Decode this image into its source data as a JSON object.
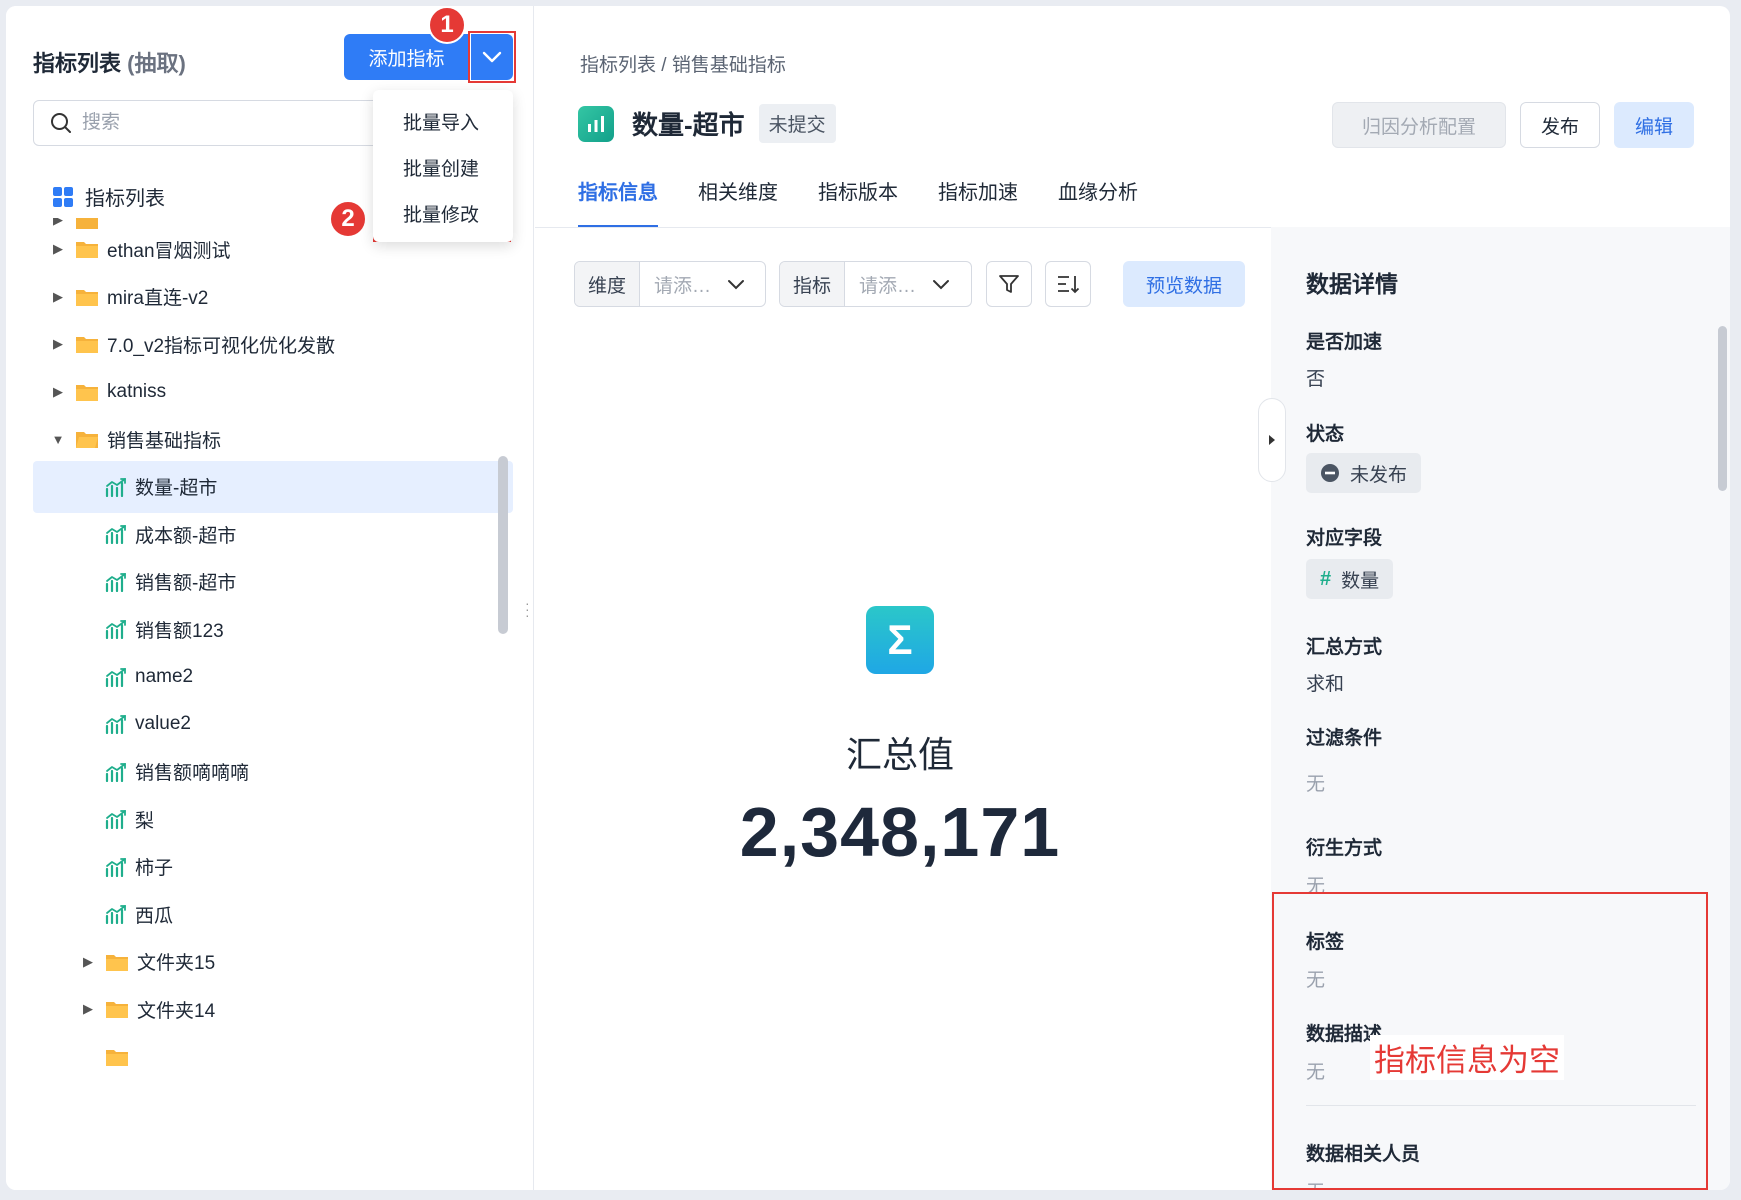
{
  "left": {
    "title": "指标列表",
    "title_suffix": "(抽取)",
    "add_button": "添加指标",
    "search_placeholder": "搜索",
    "dropdown": [
      "批量导入",
      "批量创建",
      "批量修改"
    ],
    "annotations": [
      "1",
      "2"
    ],
    "tree_root": "指标列表",
    "tree_items": [
      {
        "label": "ethan冒烟测试",
        "type": "folder",
        "level": 0,
        "expanded": false
      },
      {
        "label": "mira直连-v2",
        "type": "folder",
        "level": 0,
        "expanded": false
      },
      {
        "label": "7.0_v2指标可视化优化发散",
        "type": "folder",
        "level": 0,
        "expanded": false
      },
      {
        "label": "katniss",
        "type": "folder",
        "level": 0,
        "expanded": false
      },
      {
        "label": "销售基础指标",
        "type": "folder",
        "level": 0,
        "expanded": true
      },
      {
        "label": "数量-超市",
        "type": "metric",
        "level": 1,
        "selected": true
      },
      {
        "label": "成本额-超市",
        "type": "metric",
        "level": 1
      },
      {
        "label": "销售额-超市",
        "type": "metric",
        "level": 1
      },
      {
        "label": "销售额123",
        "type": "metric",
        "level": 1
      },
      {
        "label": "name2",
        "type": "metric",
        "level": 1
      },
      {
        "label": "value2",
        "type": "metric",
        "level": 1
      },
      {
        "label": "销售额嘀嘀嘀",
        "type": "metric",
        "level": 1
      },
      {
        "label": "梨",
        "type": "metric",
        "level": 1
      },
      {
        "label": "柿子",
        "type": "metric",
        "level": 1
      },
      {
        "label": "西瓜",
        "type": "metric",
        "level": 1
      },
      {
        "label": "文件夹15",
        "type": "folder",
        "level": 1,
        "expanded": false
      },
      {
        "label": "文件夹14",
        "type": "folder",
        "level": 1,
        "expanded": false
      }
    ]
  },
  "main": {
    "breadcrumb": "指标列表 / 销售基础指标",
    "title": "数量-超市",
    "status": "未提交",
    "buttons": {
      "attribution": "归因分析配置",
      "publish": "发布",
      "edit": "编辑"
    },
    "tabs": [
      "指标信息",
      "相关维度",
      "指标版本",
      "指标加速",
      "血缘分析"
    ],
    "filters": {
      "dimension_label": "维度",
      "dimension_placeholder": "请添…",
      "metric_label": "指标",
      "metric_placeholder": "请添…",
      "preview": "预览数据"
    },
    "summary": {
      "label": "汇总值",
      "value": "2,348,171"
    }
  },
  "detail": {
    "title": "数据详情",
    "fields": [
      {
        "label": "是否加速",
        "value": "否"
      },
      {
        "label": "状态",
        "value": "未发布"
      },
      {
        "label": "对应字段",
        "value": "数量"
      },
      {
        "label": "汇总方式",
        "value": "求和"
      },
      {
        "label": "过滤条件",
        "value": "无"
      },
      {
        "label": "衍生方式",
        "value": "无"
      },
      {
        "label": "标签",
        "value": "无"
      },
      {
        "label": "数据描述",
        "value": "无"
      },
      {
        "label": "数据相关人员",
        "value": "无"
      }
    ],
    "note": "指标信息为空"
  },
  "colors": {
    "primary": "#2f7cf6",
    "annotation_red": "#e53935",
    "metric_green": "#1fae8c",
    "folder_orange": "#f6b23b"
  }
}
